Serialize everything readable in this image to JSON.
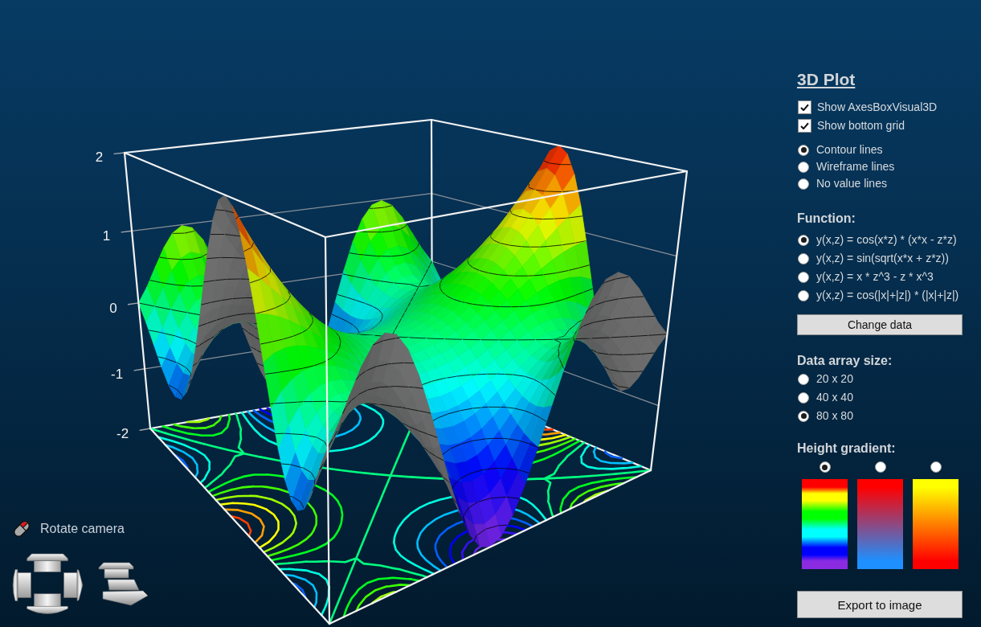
{
  "plot": {
    "y_ticks": [
      "2",
      "1",
      "0",
      "-1",
      "-2"
    ]
  },
  "camera": {
    "label": "Rotate camera"
  },
  "panel": {
    "title": "3D Plot",
    "checkboxes": [
      {
        "label": "Show AxesBoxVisual3D",
        "checked": true
      },
      {
        "label": "Show bottom grid",
        "checked": true
      }
    ],
    "line_modes": [
      {
        "label": "Contour lines",
        "selected": true
      },
      {
        "label": "Wireframe lines",
        "selected": false
      },
      {
        "label": "No value lines",
        "selected": false
      }
    ],
    "function": {
      "heading": "Function:",
      "options": [
        {
          "label": "y(x,z) = cos(x*z) * (x*x - z*z)",
          "selected": true
        },
        {
          "label": "y(x,z) = sin(sqrt(x*x + z*z))",
          "selected": false
        },
        {
          "label": "y(x,z) = x * z^3 - z * x^3",
          "selected": false
        },
        {
          "label": "y(x,z) = cos(|x|+|z|) * (|x|+|z|)",
          "selected": false
        }
      ],
      "button": "Change data"
    },
    "data_size": {
      "heading": "Data array size:",
      "options": [
        {
          "label": "20 x 20",
          "selected": false
        },
        {
          "label": "40 x 40",
          "selected": false
        },
        {
          "label": "80 x 80",
          "selected": true
        }
      ]
    },
    "height_gradient": {
      "heading": "Height gradient:",
      "options": [
        {
          "selected": true,
          "stops": [
            {
              "color": "#ff0000"
            },
            {
              "color": "#ffff00"
            },
            {
              "color": "#00ff00"
            },
            {
              "color": "#00ffff"
            },
            {
              "color": "#0000ff"
            },
            {
              "color": "#8a2be2"
            }
          ]
        },
        {
          "selected": false,
          "stops": [
            {
              "color": "#ff0000"
            },
            {
              "color": "#1e90ff"
            }
          ]
        },
        {
          "selected": false,
          "stops": [
            {
              "color": "#ffff00"
            },
            {
              "color": "#ff0000"
            }
          ]
        }
      ]
    },
    "export_button": "Export to image"
  }
}
